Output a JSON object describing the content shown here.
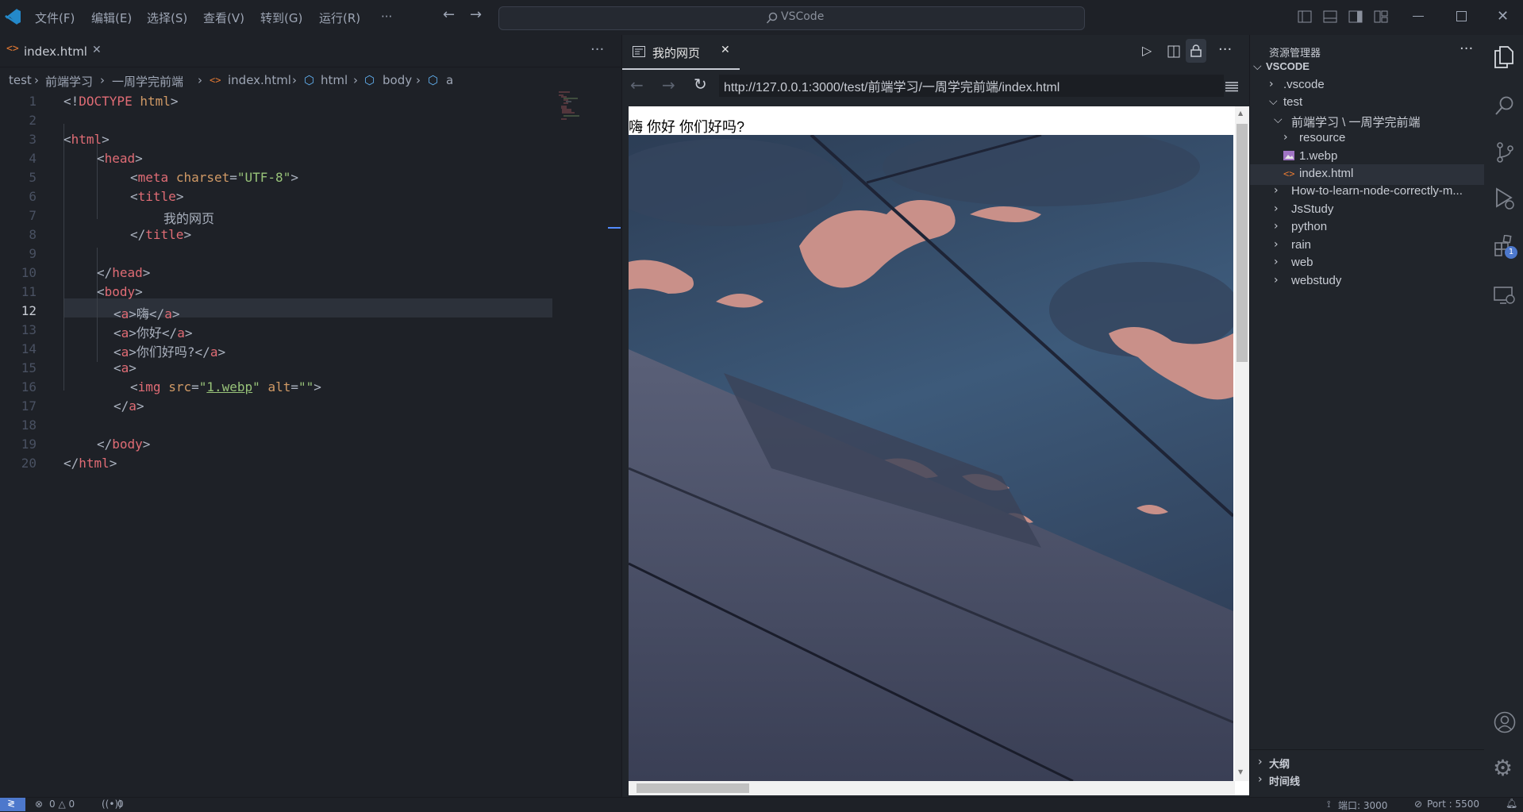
{
  "titlebar": {
    "menus": [
      "文件(F)",
      "编辑(E)",
      "选择(S)",
      "查看(V)",
      "转到(G)",
      "运行(R)",
      "···"
    ],
    "search_label": "VSCode"
  },
  "editor": {
    "tab_label": "index.html",
    "breadcrumb": [
      "test",
      "前端学习",
      "一周学完前端",
      "index.html",
      "html",
      "body",
      "a"
    ],
    "line_numbers": [
      "1",
      "2",
      "3",
      "4",
      "5",
      "6",
      "7",
      "8",
      "9",
      "10",
      "11",
      "12",
      "13",
      "14",
      "15",
      "16",
      "17",
      "18",
      "19",
      "20"
    ],
    "active_line": "12"
  },
  "preview": {
    "tab_label": "我的网页",
    "url": "http://127.0.0.1:3000/test/前端学习/一周学完前端/index.html",
    "page_text": "嗨 你好 你们好吗?"
  },
  "explorer": {
    "header": "资源管理器",
    "root": "VSCODE",
    "items": [
      ".vscode",
      "test",
      "前端学习 \\ 一周学完前端",
      "resource",
      "1.webp",
      "index.html",
      "How-to-learn-node-correctly-m...",
      "JsStudy",
      "python",
      "rain",
      "web",
      "webstudy"
    ],
    "outline": "大纲",
    "timeline": "时间线"
  },
  "activity": {
    "extensions_badge": "1"
  },
  "statusbar": {
    "problems": "0 △ 0",
    "ports": "0",
    "port_label": "端口: 3000",
    "live_port": "Port : 5500"
  },
  "colors": {
    "accent": "#528bff",
    "html_icon": "#e37933",
    "background": "#1e2127"
  }
}
